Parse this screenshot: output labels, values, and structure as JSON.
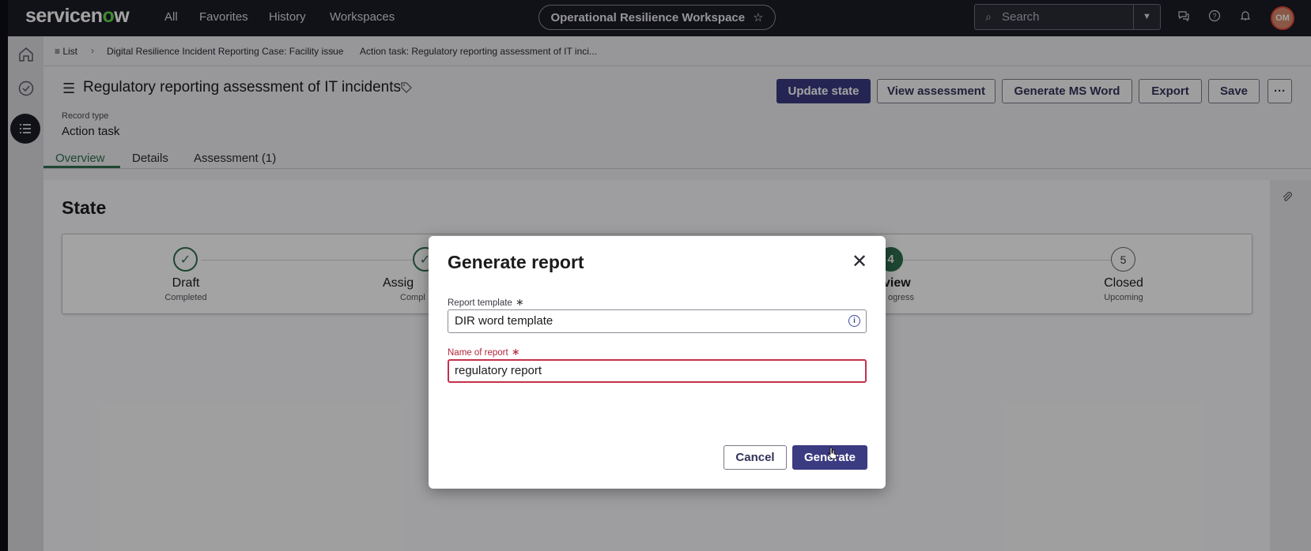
{
  "topnav": {
    "logo": {
      "a": "servicen",
      "o": "o",
      "b": "w"
    },
    "links": [
      "All",
      "Favorites",
      "History",
      "Workspaces"
    ],
    "workspace": "Operational Resilience Workspace",
    "search_placeholder": "Search",
    "avatar_initials": "OM"
  },
  "breadcrumb": {
    "list": "≡ List",
    "case": "Digital Resilience Incident Reporting Case: Facility issue",
    "task": "Action task: Regulatory reporting assessment of IT inci..."
  },
  "header": {
    "title": "Regulatory reporting assessment of IT incidents",
    "record_type_label": "Record type",
    "record_type_value": "Action task",
    "buttons": {
      "update_state": "Update state",
      "view_assessment": "View assessment",
      "generate_ms_word": "Generate MS Word",
      "export": "Export",
      "save": "Save",
      "more": "···"
    }
  },
  "tabs": [
    "Overview",
    "Details",
    "Assessment (1)"
  ],
  "state": {
    "title": "State",
    "steps": [
      {
        "label": "Draft",
        "sub": "Completed",
        "marker": "✓"
      },
      {
        "label": "Assig",
        "sub": "Compl",
        "marker": "✓"
      },
      {
        "label": "view",
        "sub": "ogress",
        "marker": "4"
      },
      {
        "label": "Closed",
        "sub": "Upcoming",
        "marker": "5"
      }
    ]
  },
  "modal": {
    "title": "Generate report",
    "template_label": "Report template",
    "template_value": "DIR word template",
    "name_label": "Name of report",
    "name_value": "regulatory report",
    "required_mark": "∗",
    "cancel": "Cancel",
    "generate": "Generate"
  },
  "colors": {
    "nav_bg": "#1c1c26",
    "primary": "#3b3b82",
    "success": "#2f6f4f",
    "error": "#c4314b",
    "logo_accent": "#62d84e"
  },
  "icons": [
    "search-icon",
    "chevron-down-icon",
    "chat-icon",
    "help-icon",
    "bell-icon",
    "home-icon",
    "check-circle-icon",
    "list-icon",
    "tag-icon",
    "paperclip-icon",
    "close-icon",
    "info-icon",
    "star-icon"
  ]
}
